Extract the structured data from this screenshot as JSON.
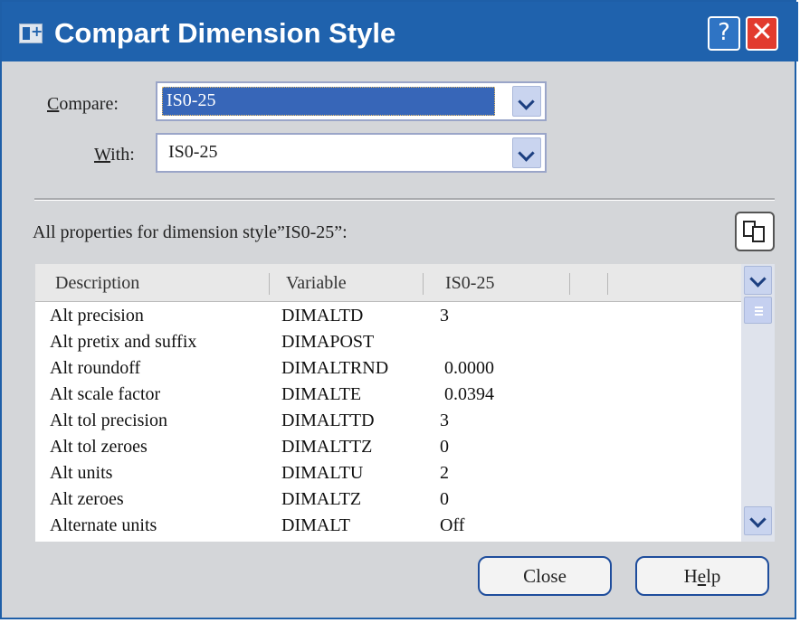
{
  "window": {
    "title": "Compart Dimension Style"
  },
  "titlebar": {
    "help_label": "?",
    "close_label": "✕"
  },
  "compare": {
    "label_mnemonic": "C",
    "label_rest": "ompare:",
    "value": "IS0-25"
  },
  "with": {
    "label_mnemonic": "W",
    "label_rest": "ith:",
    "value": "IS0-25"
  },
  "properties": {
    "label": "All properties for dimension style”IS0-25”:"
  },
  "table": {
    "columns": [
      "Description",
      "Variable",
      "IS0-25"
    ],
    "rows": [
      {
        "description": "Alt precision",
        "variable": "DIMALTD",
        "value": "3"
      },
      {
        "description": "Alt pretix and suffix",
        "variable": "DIMAPOST",
        "value": ""
      },
      {
        "description": "Alt roundoff",
        "variable": "DIMALTRND",
        "value": "0.0000"
      },
      {
        "description": "Alt scale factor",
        "variable": "DIMALTE",
        "value": "0.0394"
      },
      {
        "description": "Alt tol precision",
        "variable": "DIMALTTD",
        "value": "3"
      },
      {
        "description": "Alt tol zeroes",
        "variable": "DIMALTTZ",
        "value": "0"
      },
      {
        "description": "Alt units",
        "variable": "DIMALTU",
        "value": "2"
      },
      {
        "description": "Alt zeroes",
        "variable": "DIMALTZ",
        "value": "0"
      },
      {
        "description": "Alternate units",
        "variable": "DIMALT",
        "value": "Off"
      }
    ]
  },
  "buttons": {
    "close_label": "Close",
    "help_prefix": "H",
    "help_mnemonic": "e",
    "help_suffix": "lp"
  },
  "icons": {
    "title": "dialog-icon",
    "copy": "copy-to-clipboard-icon",
    "dropdown": "chevron-down-icon"
  },
  "colors": {
    "titlebar": "#1f62ad",
    "close": "#e23b2e",
    "selection": "#3766b8"
  }
}
